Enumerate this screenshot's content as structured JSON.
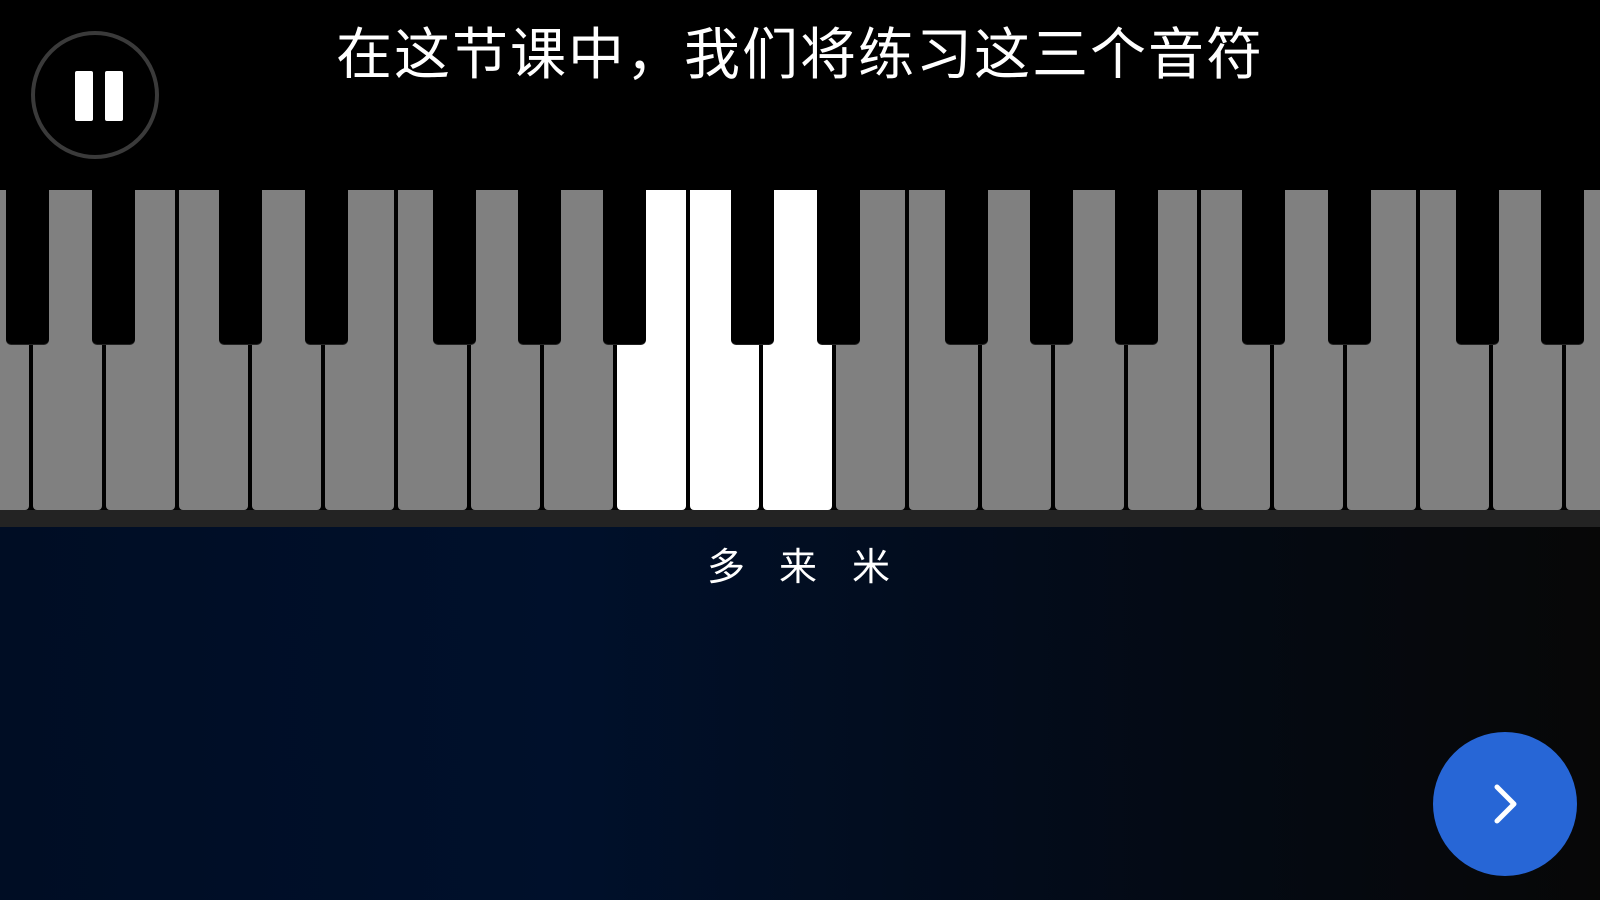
{
  "header": {
    "lesson_text": "在这节课中，我们将练习这三个音符"
  },
  "controls": {
    "pause_icon": "pause-icon",
    "next_icon": "chevron-right-icon",
    "accent_color": "#2766d6"
  },
  "keyboard": {
    "white_key_color": "#808080",
    "highlight_color": "#ffffff",
    "highlighted_notes": [
      "多",
      "来",
      "米"
    ]
  },
  "notes": {
    "labels": [
      "多",
      "来",
      "米"
    ]
  }
}
